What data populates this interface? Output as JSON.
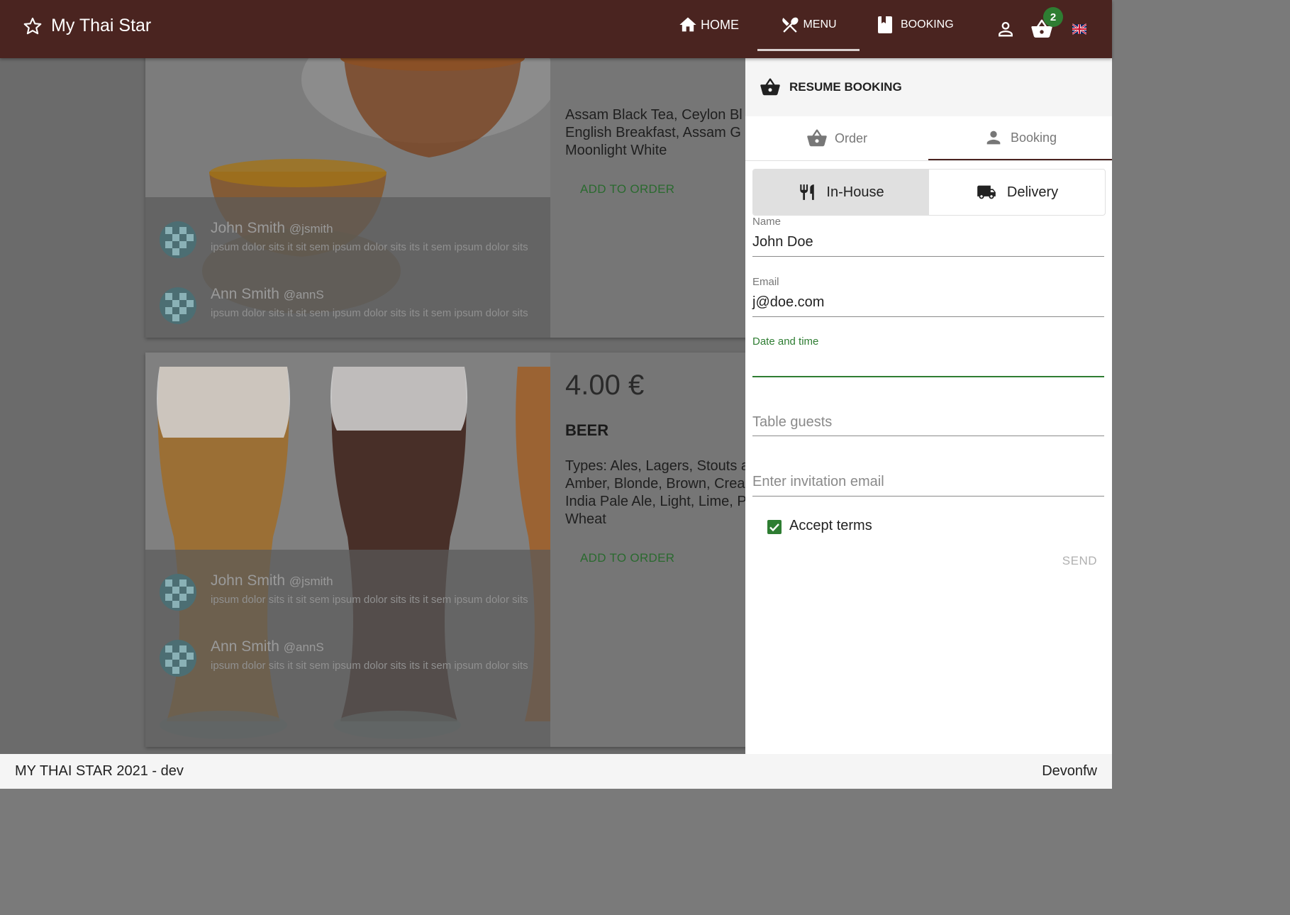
{
  "app": {
    "title": "My Thai Star"
  },
  "nav": {
    "home": "HOME",
    "menu": "MENU",
    "booking": "BOOKING",
    "cart_count": "2"
  },
  "menu_items": [
    {
      "desc_lines": [
        "Assam Black Tea, Ceylon Bl",
        "English Breakfast, Assam G",
        "Moonlight White"
      ],
      "add_label": "ADD TO ORDER",
      "comments": [
        {
          "name": "John Smith",
          "handle": "@jsmith",
          "text": "ipsum dolor sits it sit sem ipsum dolor sits its it sem ipsum dolor sits"
        },
        {
          "name": "Ann Smith",
          "handle": "@annS",
          "text": "ipsum dolor sits it sit sem ipsum dolor sits its it sem ipsum dolor sits"
        }
      ]
    },
    {
      "price": "4.00 €",
      "title": "BEER",
      "desc_lines": [
        "Types: Ales, Lagers, Stouts a",
        "Amber, Blonde, Brown, Crea",
        "India Pale Ale, Light, Lime, P",
        "Wheat"
      ],
      "add_label": "ADD TO ORDER",
      "comments": [
        {
          "name": "John Smith",
          "handle": "@jsmith",
          "text": "ipsum dolor sits it sit sem ipsum dolor sits its it sem ipsum dolor sits"
        },
        {
          "name": "Ann Smith",
          "handle": "@annS",
          "text": "ipsum dolor sits it sit sem ipsum dolor sits its it sem ipsum dolor sits"
        }
      ]
    }
  ],
  "panel": {
    "header": "RESUME BOOKING",
    "tabs": {
      "order": "Order",
      "booking": "Booking"
    },
    "toggle": {
      "inhouse": "In-House",
      "delivery": "Delivery"
    },
    "name": {
      "label": "Name",
      "value": "John Doe"
    },
    "email": {
      "label": "Email",
      "value": "j@doe.com"
    },
    "datetime": {
      "label": "Date and time"
    },
    "guests": {
      "placeholder": "Table guests"
    },
    "invite": {
      "placeholder": "Enter invitation email"
    },
    "terms": {
      "label": "Accept terms",
      "checked": true
    },
    "send": "SEND"
  },
  "footer": {
    "left": "MY THAI STAR 2021 - dev",
    "right": "Devonfw"
  },
  "colors": {
    "topbar": "#4a2420",
    "accent": "#2e7d32",
    "badge": "#2e7d32"
  }
}
